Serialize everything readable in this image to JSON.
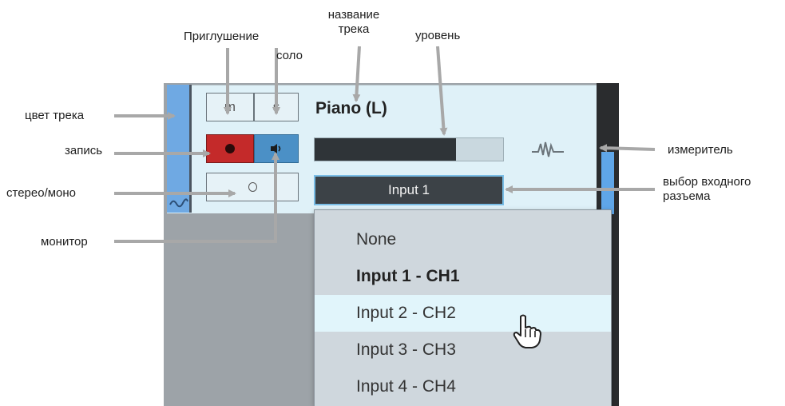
{
  "annotations": {
    "mute": "Приглушение",
    "solo": "соло",
    "track_name_line1": "название",
    "track_name_line2": "трека",
    "level": "уровень",
    "track_color": "цвет трека",
    "record": "запись",
    "stereo_mono": "стерео/моно",
    "monitor": "монитор",
    "meter": "измеритель",
    "input_select_line1": "выбор входного",
    "input_select_line2": "разъема"
  },
  "track": {
    "name": "Piano (L)",
    "color": "#6fa9e3",
    "mute_label": "m",
    "solo_label": "s",
    "level_fraction": 0.75,
    "input_selected": "Input 1"
  },
  "icons": {
    "record": "record-icon",
    "monitor": "speaker-icon",
    "mono": "mono-ring-icon",
    "waveform": "waveform-icon",
    "meter": "meter-waveform-icon",
    "cursor": "hand-pointer-icon"
  },
  "dropdown": {
    "items": [
      {
        "label": "None",
        "bold": false,
        "hover": false
      },
      {
        "label": "Input 1 - CH1",
        "bold": true,
        "hover": false
      },
      {
        "label": "Input 2 - CH2",
        "bold": false,
        "hover": true
      },
      {
        "label": "Input 3 - CH3",
        "bold": false,
        "hover": false
      },
      {
        "label": "Input 4 - CH4",
        "bold": false,
        "hover": false
      }
    ]
  }
}
